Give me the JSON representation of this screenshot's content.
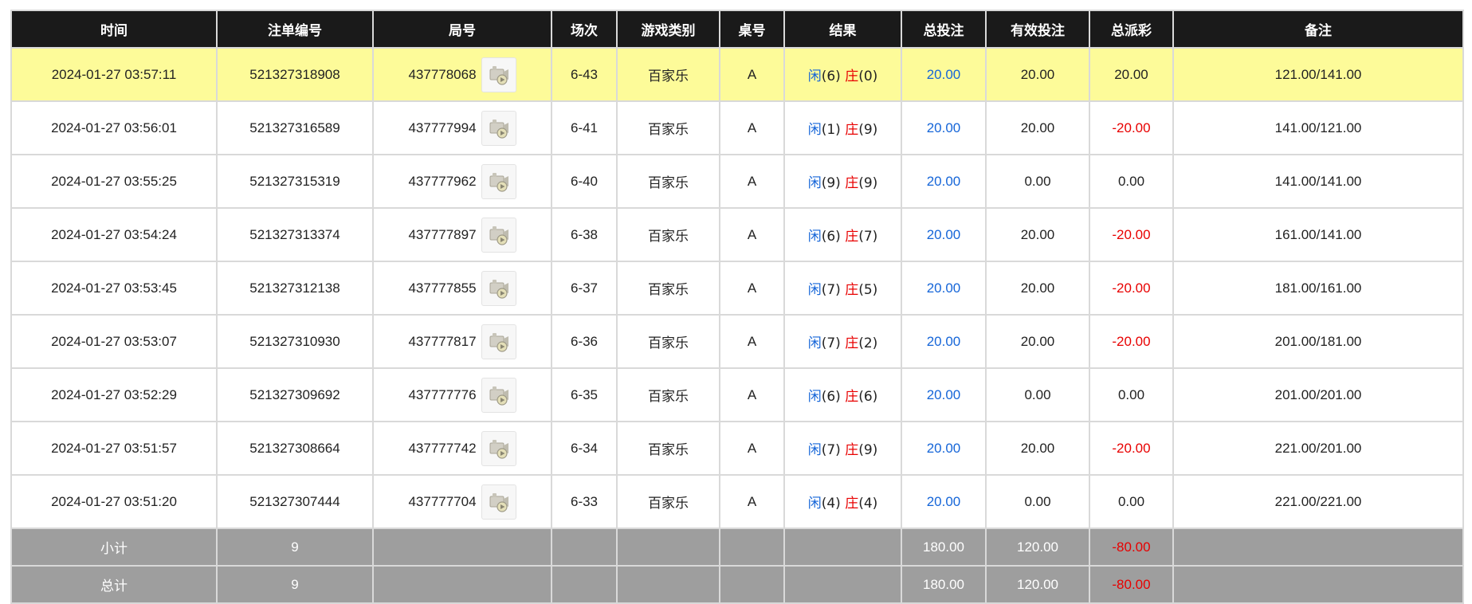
{
  "headers": [
    "时间",
    "注单编号",
    "局号",
    "场次",
    "游戏类别",
    "桌号",
    "结果",
    "总投注",
    "有效投注",
    "总派彩",
    "备注"
  ],
  "colors": {
    "header_bg": "#1a1a1a",
    "highlight_row": "#fdfb99",
    "footer_bg": "#9e9e9e",
    "blue": "#1565d8",
    "red": "#e80000"
  },
  "rows": [
    {
      "time": "2024-01-27 03:57:11",
      "bet_id": "521327318908",
      "round": "437778068",
      "video_icon": "replay-video-icon",
      "shoe": "6-43",
      "game": "百家乐",
      "table": "A",
      "player_label": "闲",
      "player_score": "(6)",
      "banker_label": "庄",
      "banker_score": "(0)",
      "total_bet": "20.00",
      "valid_bet": "20.00",
      "payout": "20.00",
      "payout_negative": false,
      "note": "121.00/141.00",
      "highlight": true
    },
    {
      "time": "2024-01-27 03:56:01",
      "bet_id": "521327316589",
      "round": "437777994",
      "video_icon": "replay-video-icon",
      "shoe": "6-41",
      "game": "百家乐",
      "table": "A",
      "player_label": "闲",
      "player_score": "(1)",
      "banker_label": "庄",
      "banker_score": "(9)",
      "total_bet": "20.00",
      "valid_bet": "20.00",
      "payout": "-20.00",
      "payout_negative": true,
      "note": "141.00/121.00",
      "highlight": false
    },
    {
      "time": "2024-01-27 03:55:25",
      "bet_id": "521327315319",
      "round": "437777962",
      "video_icon": "replay-video-icon",
      "shoe": "6-40",
      "game": "百家乐",
      "table": "A",
      "player_label": "闲",
      "player_score": "(9)",
      "banker_label": "庄",
      "banker_score": "(9)",
      "total_bet": "20.00",
      "valid_bet": "0.00",
      "payout": "0.00",
      "payout_negative": false,
      "note": "141.00/141.00",
      "highlight": false
    },
    {
      "time": "2024-01-27 03:54:24",
      "bet_id": "521327313374",
      "round": "437777897",
      "video_icon": "replay-video-icon",
      "shoe": "6-38",
      "game": "百家乐",
      "table": "A",
      "player_label": "闲",
      "player_score": "(6)",
      "banker_label": "庄",
      "banker_score": "(7)",
      "total_bet": "20.00",
      "valid_bet": "20.00",
      "payout": "-20.00",
      "payout_negative": true,
      "note": "161.00/141.00",
      "highlight": false
    },
    {
      "time": "2024-01-27 03:53:45",
      "bet_id": "521327312138",
      "round": "437777855",
      "video_icon": "replay-video-icon",
      "shoe": "6-37",
      "game": "百家乐",
      "table": "A",
      "player_label": "闲",
      "player_score": "(7)",
      "banker_label": "庄",
      "banker_score": "(5)",
      "total_bet": "20.00",
      "valid_bet": "20.00",
      "payout": "-20.00",
      "payout_negative": true,
      "note": "181.00/161.00",
      "highlight": false
    },
    {
      "time": "2024-01-27 03:53:07",
      "bet_id": "521327310930",
      "round": "437777817",
      "video_icon": "replay-video-icon",
      "shoe": "6-36",
      "game": "百家乐",
      "table": "A",
      "player_label": "闲",
      "player_score": "(7)",
      "banker_label": "庄",
      "banker_score": "(2)",
      "total_bet": "20.00",
      "valid_bet": "20.00",
      "payout": "-20.00",
      "payout_negative": true,
      "note": "201.00/181.00",
      "highlight": false
    },
    {
      "time": "2024-01-27 03:52:29",
      "bet_id": "521327309692",
      "round": "437777776",
      "video_icon": "replay-video-icon",
      "shoe": "6-35",
      "game": "百家乐",
      "table": "A",
      "player_label": "闲",
      "player_score": "(6)",
      "banker_label": "庄",
      "banker_score": "(6)",
      "total_bet": "20.00",
      "valid_bet": "0.00",
      "payout": "0.00",
      "payout_negative": false,
      "note": "201.00/201.00",
      "highlight": false
    },
    {
      "time": "2024-01-27 03:51:57",
      "bet_id": "521327308664",
      "round": "437777742",
      "video_icon": "replay-video-icon",
      "shoe": "6-34",
      "game": "百家乐",
      "table": "A",
      "player_label": "闲",
      "player_score": "(7)",
      "banker_label": "庄",
      "banker_score": "(9)",
      "total_bet": "20.00",
      "valid_bet": "20.00",
      "payout": "-20.00",
      "payout_negative": true,
      "note": "221.00/201.00",
      "highlight": false
    },
    {
      "time": "2024-01-27 03:51:20",
      "bet_id": "521327307444",
      "round": "437777704",
      "video_icon": "replay-video-icon",
      "shoe": "6-33",
      "game": "百家乐",
      "table": "A",
      "player_label": "闲",
      "player_score": "(4)",
      "banker_label": "庄",
      "banker_score": "(4)",
      "total_bet": "20.00",
      "valid_bet": "0.00",
      "payout": "0.00",
      "payout_negative": false,
      "note": "221.00/221.00",
      "highlight": false
    }
  ],
  "footer": [
    {
      "label": "小计",
      "count": "9",
      "total_bet": "180.00",
      "valid_bet": "120.00",
      "payout": "-80.00"
    },
    {
      "label": "总计",
      "count": "9",
      "total_bet": "180.00",
      "valid_bet": "120.00",
      "payout": "-80.00"
    }
  ]
}
